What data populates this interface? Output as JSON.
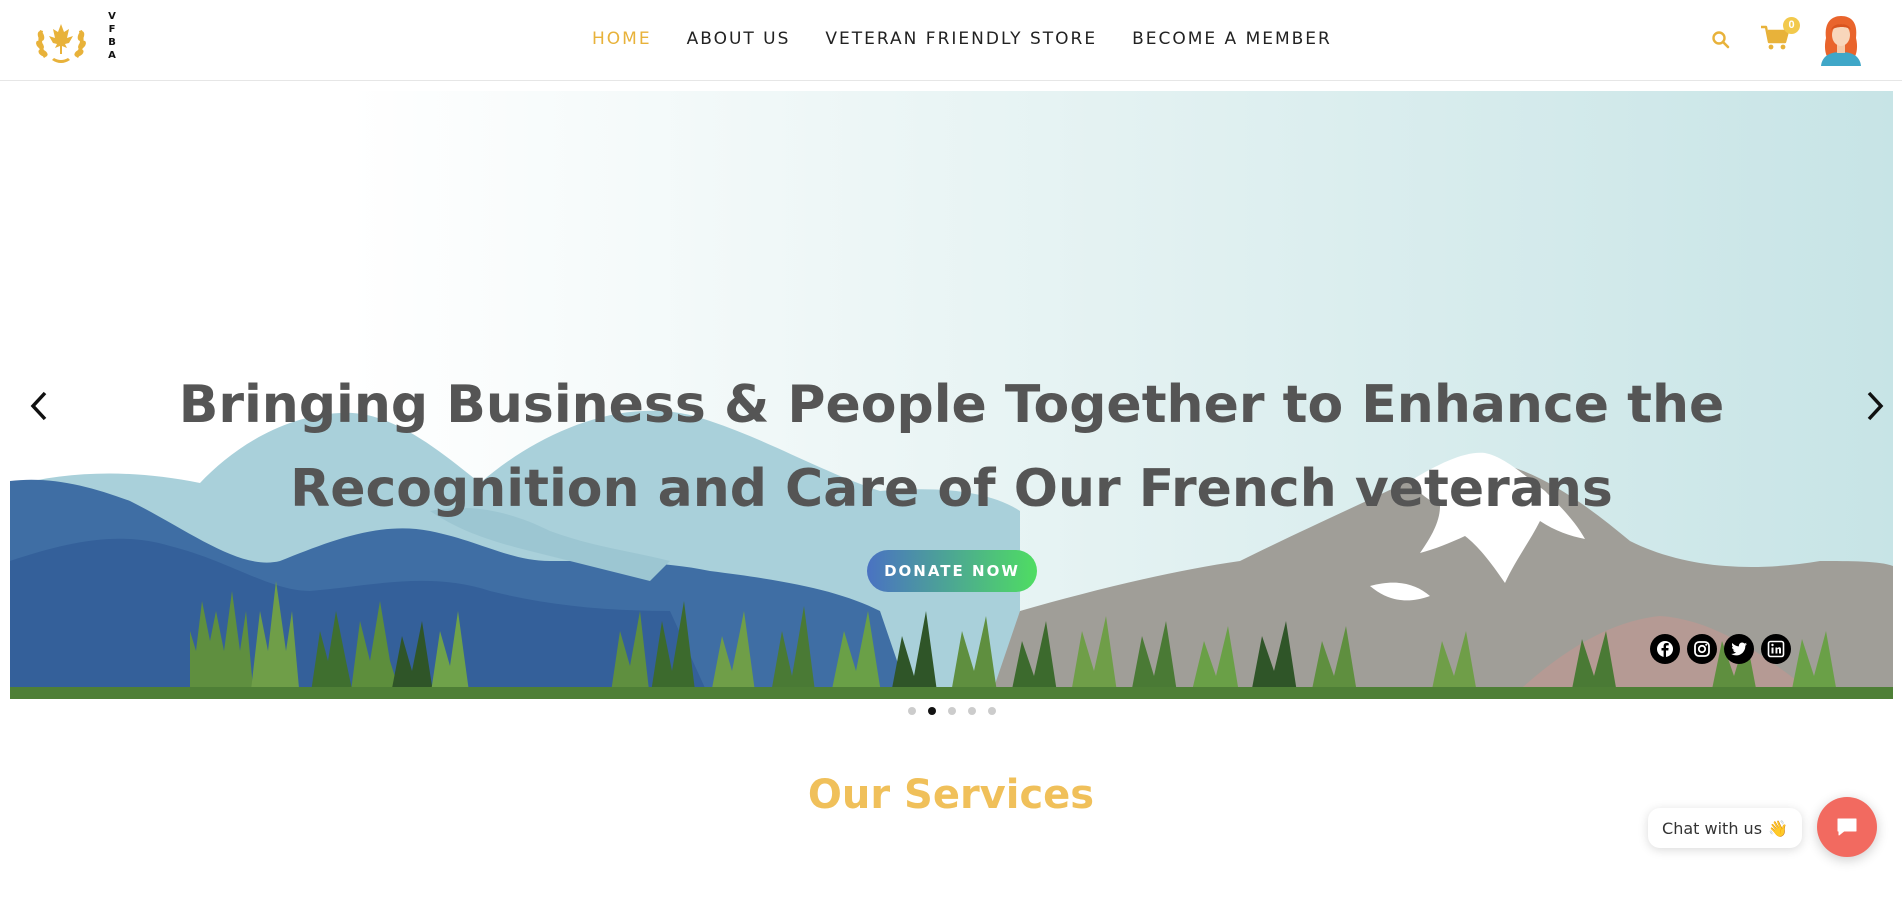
{
  "header": {
    "logo_letters": [
      "V",
      "F",
      "B",
      "A"
    ],
    "nav": [
      {
        "label": "HOME",
        "active": true
      },
      {
        "label": "ABOUT US",
        "active": false
      },
      {
        "label": "VETERAN FRIENDLY STORE",
        "active": false
      },
      {
        "label": "BECOME A MEMBER",
        "active": false
      }
    ],
    "cart_count": "0",
    "icons": [
      "search-icon",
      "cart-icon",
      "avatar"
    ]
  },
  "hero": {
    "title": "Bringing Business & People Together to Enhance the Recognition and Care of Our French veterans",
    "donate_label": "DONATE NOW",
    "social": [
      "facebook-icon",
      "instagram-icon",
      "twitter-icon",
      "linkedin-icon"
    ]
  },
  "carousel": {
    "slides": 5,
    "active_slide": 2
  },
  "services": {
    "title": "Our Services"
  },
  "chat": {
    "label": "Chat with us",
    "emoji": "👋"
  },
  "colors": {
    "accent": "#e8b23a",
    "services_title": "#f0c05a",
    "donate_start": "#4a72c2",
    "donate_end": "#4fdd62",
    "chat_button": "#f26a60"
  }
}
